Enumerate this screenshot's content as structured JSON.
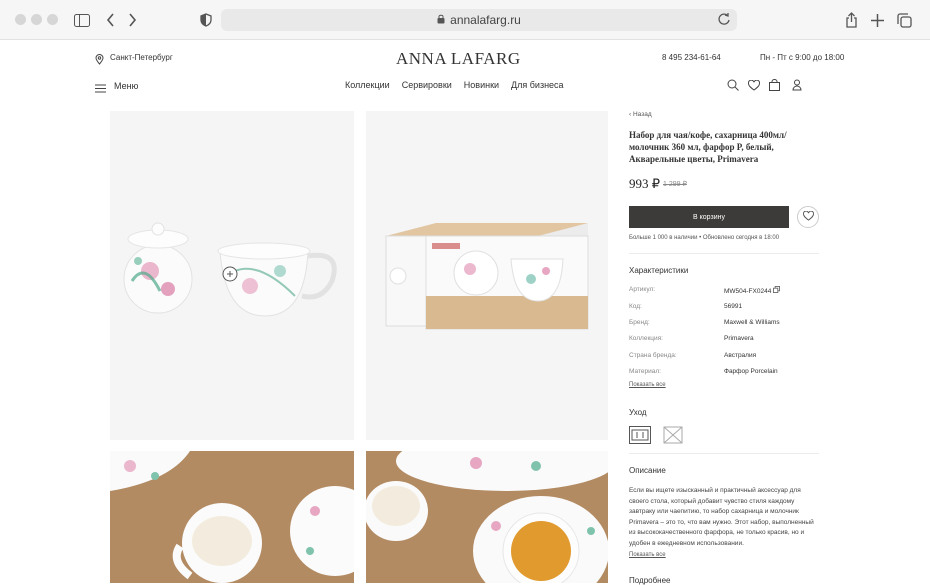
{
  "browser": {
    "url": "annalafarg.ru"
  },
  "header": {
    "city": "Санкт-Петербург",
    "logo": "ANNA LAFARG",
    "phone": "8 495 234-61-64",
    "hours": "Пн - Пт с 9:00 до 18:00",
    "menu_label": "Меню",
    "nav": [
      "Коллекции",
      "Сервировки",
      "Новинки",
      "Для бизнеса"
    ]
  },
  "product": {
    "back": "Назад",
    "title": "Набор для чая/кофе, сахарница 400мл/ молочник 360 мл, фарфор P, белый, Акварельные цветы, Primavera",
    "price": "993 ₽",
    "old_price": "1 299 ₽",
    "cart_button": "В корзину",
    "availability": "Больше 1 000 в наличии  •  Обновлено сегодня в 18:00"
  },
  "characteristics": {
    "heading": "Характеристики",
    "rows": [
      {
        "key": "Артикул:",
        "value": "MW504-FX0244"
      },
      {
        "key": "Код:",
        "value": "56991"
      },
      {
        "key": "Бренд:",
        "value": "Maxwell & Williams"
      },
      {
        "key": "Коллекция:",
        "value": "Primavera"
      },
      {
        "key": "Страна бренда:",
        "value": "Австралия"
      },
      {
        "key": "Материал:",
        "value": "Фарфор Porcelain"
      }
    ],
    "show_all": "Показать все"
  },
  "care": {
    "heading": "Уход",
    "icons": [
      "dishwasher-safe-icon",
      "no-microwave-icon"
    ]
  },
  "description": {
    "heading": "Описание",
    "text": "Если вы ищете изысканный и практичный аксессуар для своего стола, который добавит чувство стиля каждому завтраку или чаепитию, то набор сахарница и молочник Primavera – это то, что вам нужно. Этот набор, выполненный из высококачественного фарфора, не только красив, но и удобен в ежедневном использовании.",
    "show_all": "Показать все",
    "bottom": "Подробнее"
  }
}
